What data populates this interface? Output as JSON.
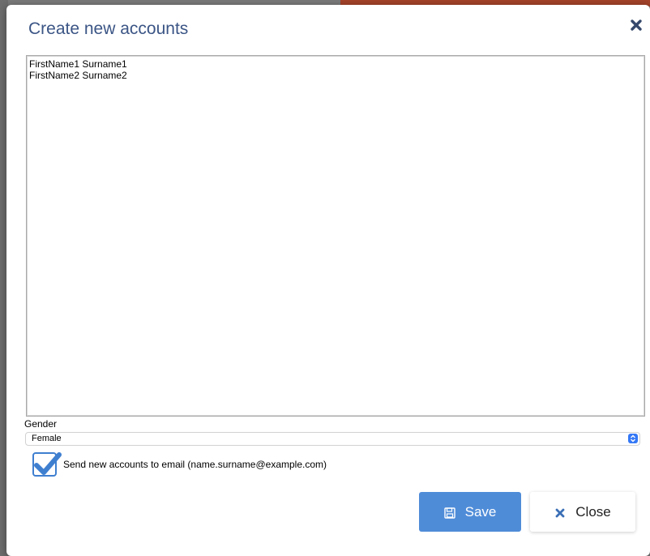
{
  "dialog": {
    "title": "Create new accounts",
    "textarea_lines": [
      "FirstName1 Surname1",
      "FirstName2 Surname2"
    ]
  },
  "gender": {
    "label": "Gender",
    "selected": "Female"
  },
  "send_email": {
    "label": "Send new accounts to email (name.surname@example.com)",
    "checked": true
  },
  "buttons": {
    "save_label": "Save",
    "close_label": "Close"
  },
  "icons": {
    "close": "close-icon",
    "save": "floppy-disk-icon",
    "check": "checkmark-icon",
    "select": "select-arrows-icon"
  },
  "colors": {
    "title": "#3b5585",
    "primary": "#4f8cd8",
    "checkbox": "#3f7fd0"
  }
}
